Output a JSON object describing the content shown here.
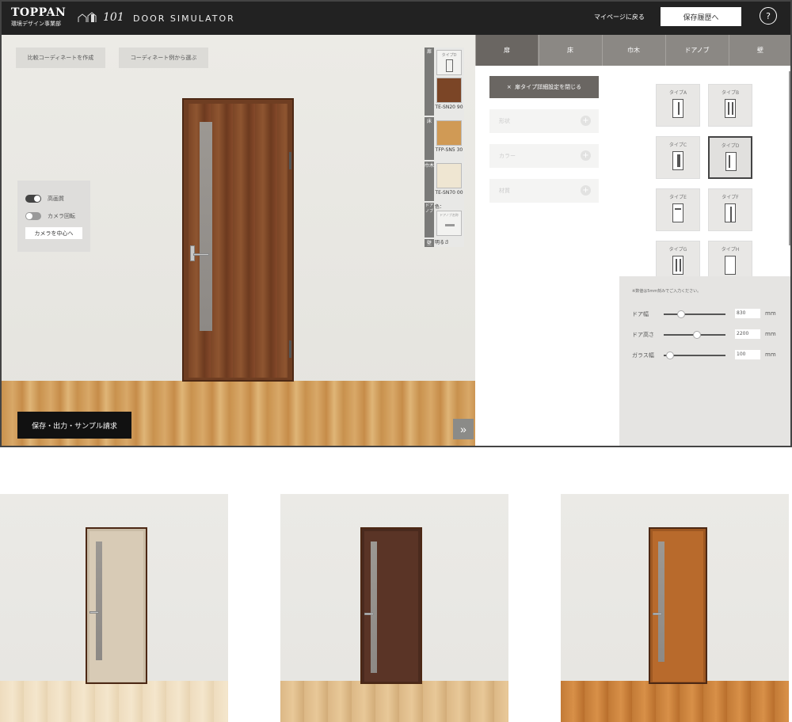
{
  "header": {
    "logo": "TOPPAN",
    "logo_sub": "環境デザイン事業部",
    "app_mark": "101",
    "app_name": "DOOR SIMULATOR",
    "mypage_link": "マイページに戻る",
    "history_button": "保存履歴へ",
    "help_button": "?"
  },
  "scene": {
    "compare_button": "比較コーディネートを作成",
    "examples_button": "コーディネート例から選ぶ",
    "toggles": [
      {
        "label": "高画質",
        "on": true
      },
      {
        "label": "カメラ回転",
        "on": false
      }
    ],
    "center_camera_button": "カメラを中心へ",
    "save_button": "保存・出力・サンプル請求",
    "expand_icon": "double-chevron-right-icon"
  },
  "swatch_strip": {
    "tabs": [
      "扉",
      "床",
      "巾木",
      "ドアノブ",
      "壁"
    ],
    "type_label": "タイプD",
    "door_code": "TE-SN20 90",
    "floor_code": "TFP-SN5 30",
    "baseboard_code": "TE-SN70 00",
    "color_label": "色：",
    "knob_label": "ドアノブ名称",
    "brightness_label": "明るさ",
    "colors": {
      "door": "#7b4526",
      "floor": "#d09a55",
      "baseboard": "#efe6d2"
    }
  },
  "panel": {
    "tabs": [
      "扉",
      "床",
      "巾木",
      "ドアノブ",
      "壁"
    ],
    "active_tab": "扉",
    "close_detail_button": "扉タイプ詳細設定を閉じる",
    "close_icon": "×",
    "accordions": [
      "形状",
      "カラー",
      "材質"
    ],
    "types": [
      "タイプA",
      "タイプB",
      "タイプC",
      "タイプD",
      "タイプE",
      "タイプF",
      "タイプG",
      "タイプH"
    ],
    "selected_type": "タイプD",
    "param_note": "※数値は5mm刻みでご入力ください。",
    "params": [
      {
        "label": "ドア幅",
        "value": "830",
        "unit": "mm",
        "level": 0.25
      },
      {
        "label": "ドア高さ",
        "value": "2200",
        "unit": "mm",
        "level": 0.55
      },
      {
        "label": "ガラス幅",
        "value": "100",
        "unit": "mm",
        "level": 0.05
      }
    ]
  },
  "samples": [
    {
      "door_color": "#d8cbb6",
      "frame_color": "#c9bca6"
    },
    {
      "door_color": "#5a3426",
      "frame_color": "#4a2a1e"
    },
    {
      "door_color": "#b86a2c",
      "frame_color": "#9e5822"
    }
  ]
}
